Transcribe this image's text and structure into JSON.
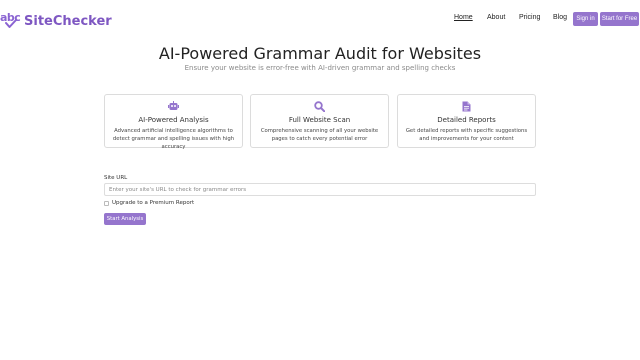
{
  "brand": {
    "logo_text": "abc",
    "name": "SiteChecker"
  },
  "nav": {
    "links": [
      {
        "label": "Home",
        "active": true
      },
      {
        "label": "About",
        "active": false
      },
      {
        "label": "Pricing",
        "active": false
      },
      {
        "label": "Blog",
        "active": false
      }
    ],
    "sign_in": "Sign in",
    "start_free": "Start for Free"
  },
  "hero": {
    "title": "AI-Powered Grammar Audit for Websites",
    "subtitle": "Ensure your website is error-free with AI-driven grammar and spelling checks"
  },
  "features": [
    {
      "icon": "robot-icon",
      "title": "AI-Powered Analysis",
      "description": "Advanced artificial intelligence algorithms to detect grammar and spelling issues with high accuracy"
    },
    {
      "icon": "search-icon",
      "title": "Full Website Scan",
      "description": "Comprehensive scanning of all your website pages to catch every potential error"
    },
    {
      "icon": "document-icon",
      "title": "Detailed Reports",
      "description": "Get detailed reports with specific suggestions and improvements for your content"
    }
  ],
  "form": {
    "url_label": "Site URL",
    "url_placeholder": "Enter your site's URL to check for grammar errors",
    "premium_label": "Upgrade to a Premium Report",
    "premium_checked": false,
    "submit_label": "Start Analysis"
  },
  "colors": {
    "accent": "#9575cd",
    "brand": "#7e57c2"
  }
}
